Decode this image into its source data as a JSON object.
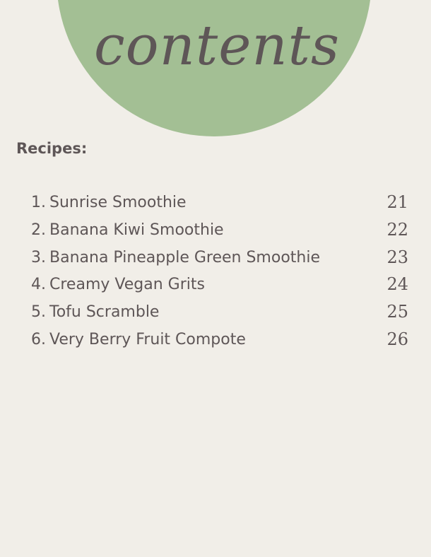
{
  "title": "contents",
  "section_label": "Recipes:",
  "colors": {
    "background": "#f1eee8",
    "circle": "#a3bf94",
    "text": "#5e5657"
  },
  "entries": [
    {
      "number": "1.",
      "title": "Sunrise Smoothie",
      "page": "21"
    },
    {
      "number": "2.",
      "title": "Banana Kiwi Smoothie",
      "page": "22"
    },
    {
      "number": "3.",
      "title": "Banana Pineapple Green Smoothie",
      "page": "23"
    },
    {
      "number": "4.",
      "title": "Creamy Vegan Grits",
      "page": "24"
    },
    {
      "number": "5.",
      "title": "Tofu Scramble",
      "page": "25"
    },
    {
      "number": "6.",
      "title": "Very Berry Fruit Compote",
      "page": "26"
    }
  ]
}
